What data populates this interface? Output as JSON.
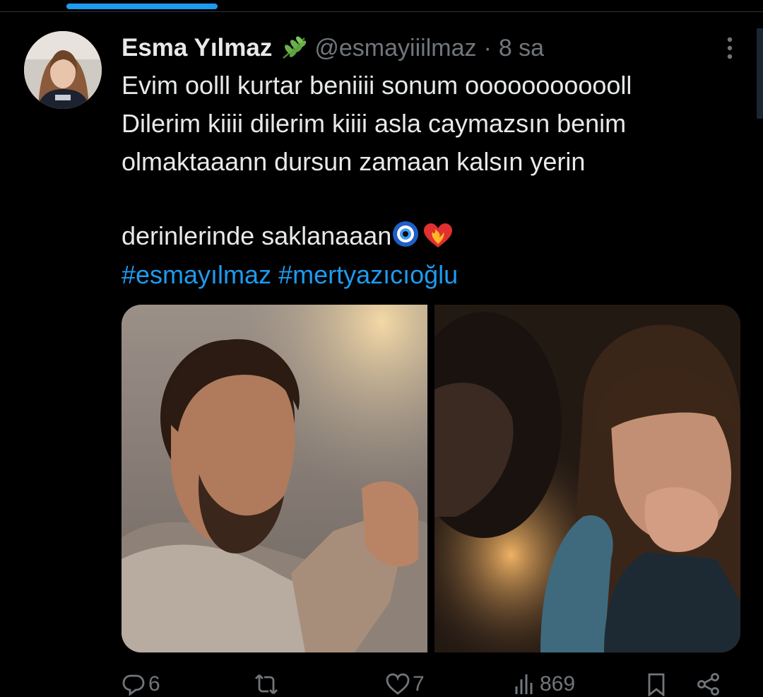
{
  "accent_color": "#1d9bf0",
  "tweet": {
    "author_name": "Esma Yılmaz",
    "badge_emoji": "🌿",
    "handle": "@esmayiiilmaz",
    "separator": "·",
    "time": "8 sa",
    "text": "Evim oolll kurtar beniiii sonum oooooooooooll\nDilerim kiiii dilerim kiiii asla caymazsın benim\nolmaktaaann dursun zamaan kalsın yerin\nderinlerinde saklanaaan",
    "text_emojis": "🧿 ❤️‍🔥",
    "hashtags": [
      "#esmayılmaz",
      "#mertyazıcıoğlu"
    ],
    "media": [
      {
        "description_icon": "photo-man"
      },
      {
        "description_icon": "photo-woman"
      }
    ],
    "actions": {
      "replies": "6",
      "retweets": "",
      "likes": "7",
      "views": "869"
    }
  }
}
